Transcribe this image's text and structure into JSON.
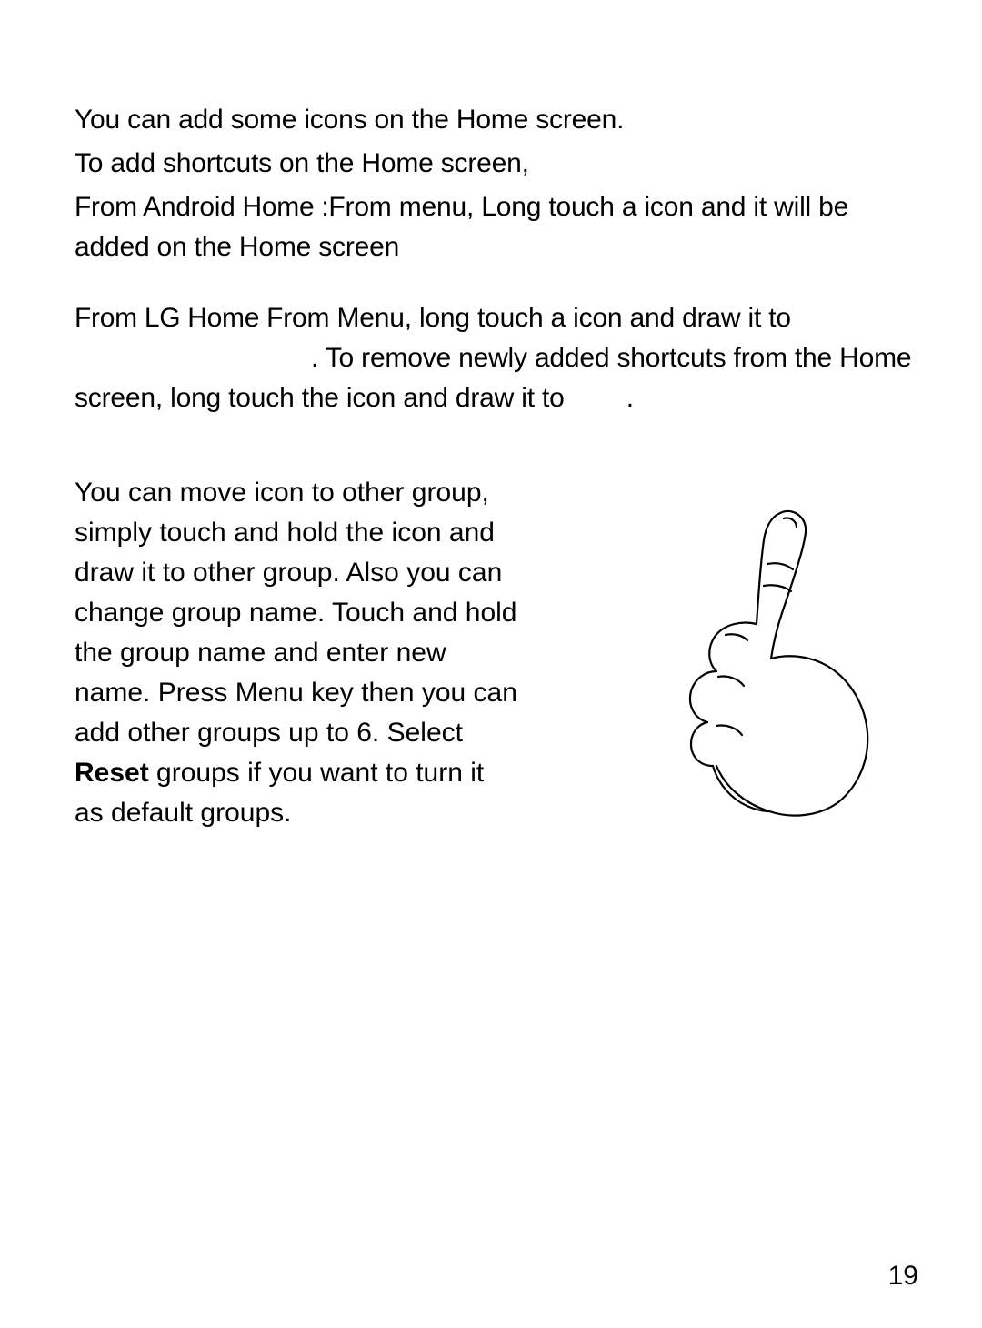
{
  "page": {
    "intro_line1": "You can add some icons on the Home screen.",
    "intro_line2": "To add shortcuts on the Home screen,",
    "android_label": "From Android Home :",
    "android_text": "From menu, Long touch a icon and it will be added on the Home screen",
    "lg_label": "From LG Home ",
    "lg_text_a": "From Menu, long touch a icon and draw it to ",
    "lg_text_b": ". To remove newly added shortcuts from the Home screen, long touch the icon and draw it to ",
    "lg_text_c": ".",
    "move_text_a": "You can move icon to other group, simply touch and hold the icon and draw it to other group. Also you can change group name. Touch and hold the group name and enter new name. Press Menu key then you can add other groups up to 6. Select ",
    "reset_label": "Reset",
    "move_text_b": " groups if you want to turn it as default groups.",
    "page_number": "19"
  }
}
